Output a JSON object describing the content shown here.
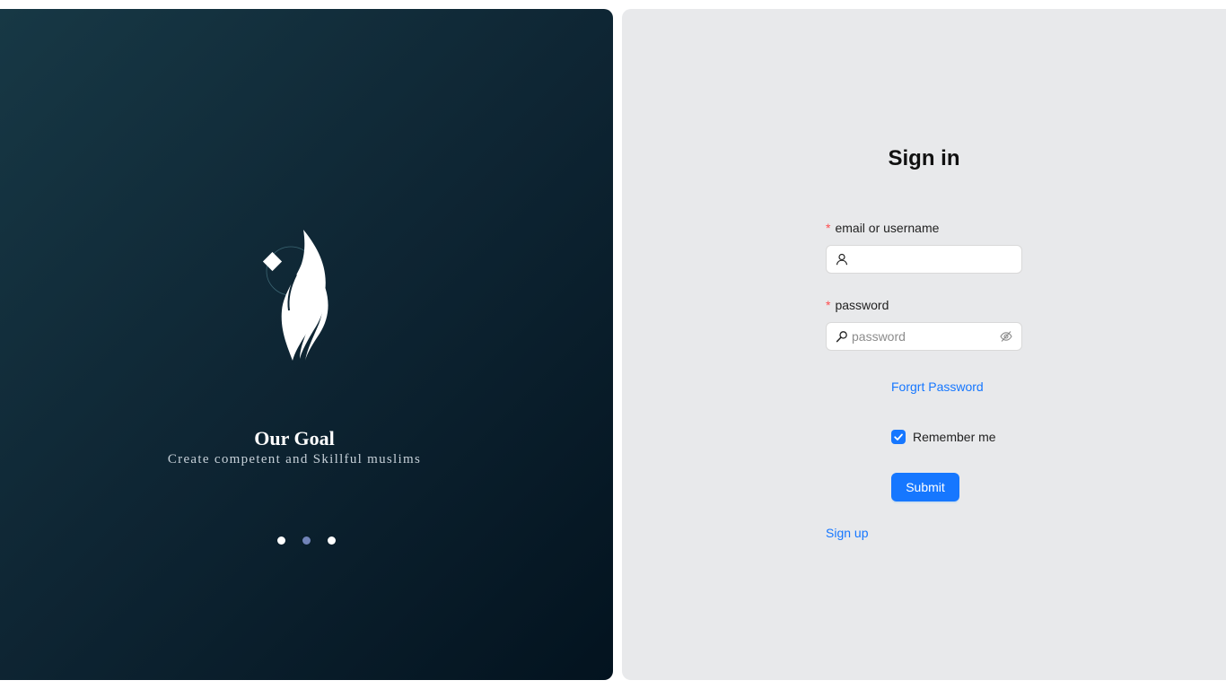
{
  "showcase": {
    "title": "Our Goal",
    "subtitle": "Create competent and Skillful muslims",
    "carousel_dots": 3,
    "active_dot": 2
  },
  "signin": {
    "title": "Sign in",
    "username_label": "email or username",
    "username_value": "",
    "username_placeholder": "",
    "password_label": "password",
    "password_placeholder": "password",
    "required_marker": "*",
    "forgot_link": "Forgrt Password",
    "remember_label": "Remember me",
    "remember_checked": true,
    "submit_label": "Submit",
    "signup_link": "Sign up"
  },
  "icons": {
    "username": "user-icon",
    "password": "key-icon",
    "toggle_visibility": "eye-off-icon"
  },
  "colors": {
    "primary": "#1677ff",
    "required": "#ff4d4f",
    "form_background": "#e8e9eb",
    "showcase_gradient_start": "#173845",
    "showcase_gradient_end": "#03131f"
  }
}
